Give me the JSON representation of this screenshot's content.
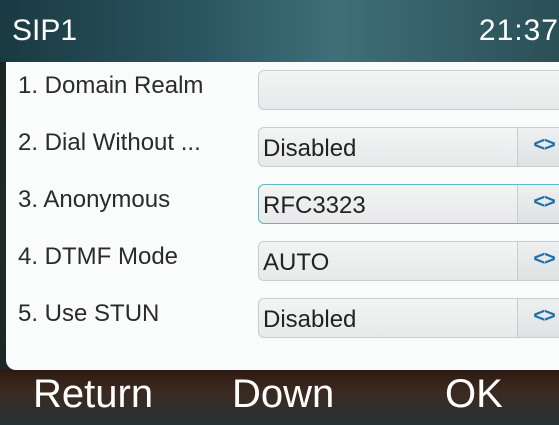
{
  "header": {
    "title": "SIP1",
    "time": "21:37"
  },
  "rows": [
    {
      "label": "1. Domain Realm",
      "value": "",
      "has_selector": false
    },
    {
      "label": "2. Dial Without ...",
      "value": "Disabled",
      "has_selector": true
    },
    {
      "label": "3. Anonymous",
      "value": "RFC3323",
      "has_selector": true,
      "focused": true
    },
    {
      "label": "4. DTMF Mode",
      "value": "AUTO",
      "has_selector": true
    },
    {
      "label": "5. Use STUN",
      "value": "Disabled",
      "has_selector": true
    }
  ],
  "selector_icon": "<>",
  "softkeys": {
    "left": "Return",
    "middle": "Down",
    "right": "OK"
  },
  "colors": {
    "accent": "#1f6fa8",
    "focus": "#5fb8c6"
  }
}
